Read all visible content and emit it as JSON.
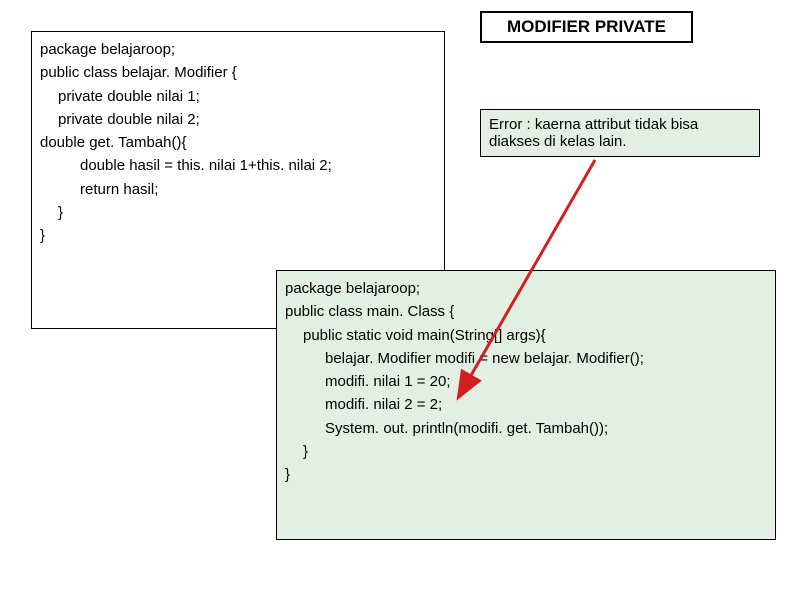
{
  "title": "MODIFIER PRIVATE",
  "error_text": "Error : kaerna attribut tidak bisa diakses di kelas lain.",
  "box1": {
    "l1": "package belajaroop;",
    "l2": "public class belajar. Modifier {",
    "l3": "private double nilai 1;",
    "l4": "private double nilai 2;",
    "l5": "double get. Tambah(){",
    "l6": "double hasil = this. nilai 1+this. nilai 2;",
    "l7": "return hasil;",
    "l8": "}",
    "l9": "}"
  },
  "box2": {
    "l1": "package belajaroop;",
    "l2": "public class main. Class {",
    "l3": "public static void main(String[] args){",
    "l4": "belajar. Modifier modifi = new belajar. Modifier();",
    "l5": "modifi. nilai 1 = 20;",
    "l6": "modifi. nilai 2 = 2;",
    "l7": "System. out. println(modifi. get. Tambah());",
    "l8": "}",
    "l9": "}"
  }
}
